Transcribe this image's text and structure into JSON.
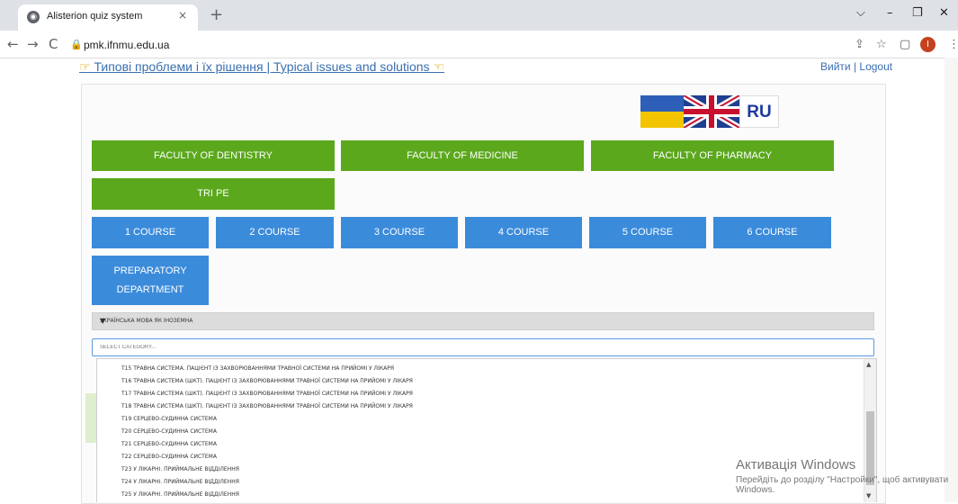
{
  "browser": {
    "tab_title": "Alisterion quiz system",
    "tab_close": "×",
    "new_tab": "+",
    "url": "pmk.ifnmu.edu.ua",
    "profile_initial": "I",
    "window_controls": {
      "dropdown": "⌵",
      "minimize": "–",
      "restore": "❐",
      "close": "✕"
    },
    "nav": {
      "back": "←",
      "forward": "→",
      "reload": "C"
    }
  },
  "header": {
    "issues_link": "Типові проблеми і їх рішення | Typical issues and solutions",
    "logout": "Вийти | Logout"
  },
  "languages": {
    "ru_label": "RU"
  },
  "faculties": [
    "FACULTY OF DENTISTRY",
    "FACULTY OF MEDICINE",
    "FACULTY OF PHARMACY",
    "TRI PE"
  ],
  "courses": [
    "1 COURSE",
    "2 COURSE",
    "3 COURSE",
    "4 COURSE",
    "5 COURSE",
    "6 COURSE"
  ],
  "preparatory": "PREPARATORY DEPARTMENT",
  "subject_select": {
    "value": "УКРАЇНСЬКА МОВА ЯК ІНОЗЕМНА",
    "arrow": "▼"
  },
  "category_input": {
    "placeholder": "SELECT CATEGORY..."
  },
  "category_options": [
    "T15 ТРАВНА СИСТЕМА. ПАЦІЄНТ ІЗ ЗАХВОРЮВАННЯМИ ТРАВНОЇ СИСТЕМИ НА ПРИЙОМІ У ЛІКАРЯ",
    "T16 ТРАВНА СИСТЕМА (ШКТ). ПАЦІЄНТ ІЗ ЗАХВОРЮВАННЯМИ ТРАВНОЇ СИСТЕМИ НА ПРИЙОМІ У ЛІКАРЯ",
    "T17 ТРАВНА СИСТЕМА (ШКТ). ПАЦІЄНТ ІЗ ЗАХВОРЮВАННЯМИ ТРАВНОЇ СИСТЕМИ НА ПРИЙОМІ У ЛІКАРЯ",
    "T18 ТРАВНА СИСТЕМА (ШКТ). ПАЦІЄНТ ІЗ ЗАХВОРЮВАННЯМИ ТРАВНОЇ СИСТЕМИ НА ПРИЙОМІ У ЛІКАРЯ",
    "T19 СЕРЦЕВО-СУДИННА СИСТЕМА",
    "T20 СЕРЦЕВО-СУДИННА СИСТЕМА",
    "T21 СЕРЦЕВО-СУДИННА СИСТЕМА",
    "T22 СЕРЦЕВО-СУДИННА СИСТЕМА",
    "T23 У ЛІКАРНІ. ПРИЙМАЛЬНЕ ВІДДІЛЕННЯ",
    "T24 У ЛІКАРНІ. ПРИЙМАЛЬНЕ ВІДДІЛЕННЯ",
    "T25 У ЛІКАРНІ. ПРИЙМАЛЬНЕ ВІДДІЛЕННЯ"
  ],
  "activation": {
    "title": "Активація Windows",
    "subtitle": "Перейдіть до розділу \"Настройки\", щоб активувати Windows."
  },
  "colors": {
    "green": "#5ba81d",
    "blue": "#3b8bdb",
    "link": "#3a6fb0"
  },
  "icons": [
    "globe-icon",
    "lock-icon",
    "share-icon",
    "star-icon",
    "sidepanel-icon",
    "menu-dots-icon",
    "hand-pointing-icon"
  ]
}
